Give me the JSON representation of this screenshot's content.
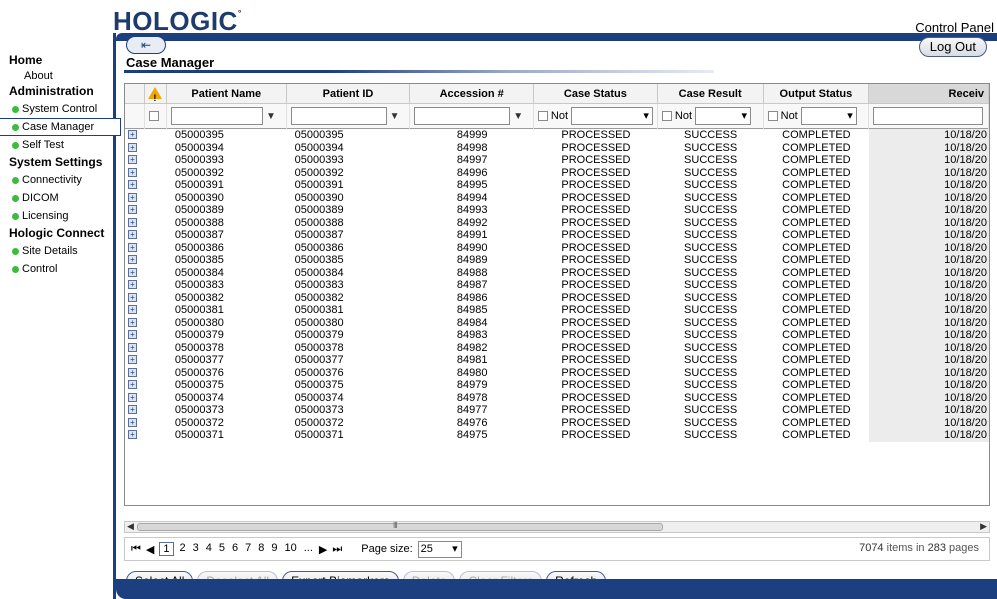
{
  "header": {
    "logo": "HOLOGIC",
    "title": "Control Panel"
  },
  "sidebar": [
    {
      "type": "head",
      "label": "Home"
    },
    {
      "type": "plain",
      "label": "About"
    },
    {
      "type": "head",
      "label": "Administration"
    },
    {
      "type": "item",
      "label": "System Control"
    },
    {
      "type": "item",
      "label": "Case Manager",
      "active": true
    },
    {
      "type": "item",
      "label": "Self Test"
    },
    {
      "type": "head",
      "label": "System Settings"
    },
    {
      "type": "item",
      "label": "Connectivity"
    },
    {
      "type": "item",
      "label": "DICOM"
    },
    {
      "type": "item",
      "label": "Licensing"
    },
    {
      "type": "head",
      "label": "Hologic Connect"
    },
    {
      "type": "item",
      "label": "Site Details"
    },
    {
      "type": "item",
      "label": "Control"
    }
  ],
  "page": {
    "title": "Case Manager",
    "logout": "Log Out"
  },
  "grid": {
    "columns": [
      "Patient Name",
      "Patient ID",
      "Accession #",
      "Case Status",
      "Case Result",
      "Output Status",
      "Receiv"
    ],
    "not_label": "Not",
    "rows": [
      [
        "05000395",
        "05000395",
        "84999",
        "PROCESSED",
        "SUCCESS",
        "COMPLETED",
        "10/18/20"
      ],
      [
        "05000394",
        "05000394",
        "84998",
        "PROCESSED",
        "SUCCESS",
        "COMPLETED",
        "10/18/20"
      ],
      [
        "05000393",
        "05000393",
        "84997",
        "PROCESSED",
        "SUCCESS",
        "COMPLETED",
        "10/18/20"
      ],
      [
        "05000392",
        "05000392",
        "84996",
        "PROCESSED",
        "SUCCESS",
        "COMPLETED",
        "10/18/20"
      ],
      [
        "05000391",
        "05000391",
        "84995",
        "PROCESSED",
        "SUCCESS",
        "COMPLETED",
        "10/18/20"
      ],
      [
        "05000390",
        "05000390",
        "84994",
        "PROCESSED",
        "SUCCESS",
        "COMPLETED",
        "10/18/20"
      ],
      [
        "05000389",
        "05000389",
        "84993",
        "PROCESSED",
        "SUCCESS",
        "COMPLETED",
        "10/18/20"
      ],
      [
        "05000388",
        "05000388",
        "84992",
        "PROCESSED",
        "SUCCESS",
        "COMPLETED",
        "10/18/20"
      ],
      [
        "05000387",
        "05000387",
        "84991",
        "PROCESSED",
        "SUCCESS",
        "COMPLETED",
        "10/18/20"
      ],
      [
        "05000386",
        "05000386",
        "84990",
        "PROCESSED",
        "SUCCESS",
        "COMPLETED",
        "10/18/20"
      ],
      [
        "05000385",
        "05000385",
        "84989",
        "PROCESSED",
        "SUCCESS",
        "COMPLETED",
        "10/18/20"
      ],
      [
        "05000384",
        "05000384",
        "84988",
        "PROCESSED",
        "SUCCESS",
        "COMPLETED",
        "10/18/20"
      ],
      [
        "05000383",
        "05000383",
        "84987",
        "PROCESSED",
        "SUCCESS",
        "COMPLETED",
        "10/18/20"
      ],
      [
        "05000382",
        "05000382",
        "84986",
        "PROCESSED",
        "SUCCESS",
        "COMPLETED",
        "10/18/20"
      ],
      [
        "05000381",
        "05000381",
        "84985",
        "PROCESSED",
        "SUCCESS",
        "COMPLETED",
        "10/18/20"
      ],
      [
        "05000380",
        "05000380",
        "84984",
        "PROCESSED",
        "SUCCESS",
        "COMPLETED",
        "10/18/20"
      ],
      [
        "05000379",
        "05000379",
        "84983",
        "PROCESSED",
        "SUCCESS",
        "COMPLETED",
        "10/18/20"
      ],
      [
        "05000378",
        "05000378",
        "84982",
        "PROCESSED",
        "SUCCESS",
        "COMPLETED",
        "10/18/20"
      ],
      [
        "05000377",
        "05000377",
        "84981",
        "PROCESSED",
        "SUCCESS",
        "COMPLETED",
        "10/18/20"
      ],
      [
        "05000376",
        "05000376",
        "84980",
        "PROCESSED",
        "SUCCESS",
        "COMPLETED",
        "10/18/20"
      ],
      [
        "05000375",
        "05000375",
        "84979",
        "PROCESSED",
        "SUCCESS",
        "COMPLETED",
        "10/18/20"
      ],
      [
        "05000374",
        "05000374",
        "84978",
        "PROCESSED",
        "SUCCESS",
        "COMPLETED",
        "10/18/20"
      ],
      [
        "05000373",
        "05000373",
        "84977",
        "PROCESSED",
        "SUCCESS",
        "COMPLETED",
        "10/18/20"
      ],
      [
        "05000372",
        "05000372",
        "84976",
        "PROCESSED",
        "SUCCESS",
        "COMPLETED",
        "10/18/20"
      ],
      [
        "05000371",
        "05000371",
        "84975",
        "PROCESSED",
        "SUCCESS",
        "COMPLETED",
        "10/18/20"
      ]
    ]
  },
  "scrollbar": {
    "grip": "III"
  },
  "pager": {
    "first": "⏮",
    "prev": "◀",
    "pages": [
      "1",
      "2",
      "3",
      "4",
      "5",
      "6",
      "7",
      "8",
      "9",
      "10",
      "..."
    ],
    "current": "1",
    "next": "▶",
    "last": "⏭",
    "size_label": "Page size:",
    "size_value": "25",
    "items": "7074",
    "items_suffix": "items in",
    "pages_count": "283",
    "pages_suffix": "pages"
  },
  "actions": [
    {
      "label": "Select All",
      "enabled": true
    },
    {
      "label": "Deselect All",
      "enabled": false
    },
    {
      "label": "Export Biomarkers",
      "enabled": true
    },
    {
      "label": "Delete",
      "enabled": false
    },
    {
      "label": "Clear Filters",
      "enabled": false
    },
    {
      "label": "Refresh",
      "enabled": true
    }
  ],
  "colors": {
    "brand": "#1c3f80",
    "status_green": "#3dbb3d",
    "warning": "#f0a800"
  }
}
